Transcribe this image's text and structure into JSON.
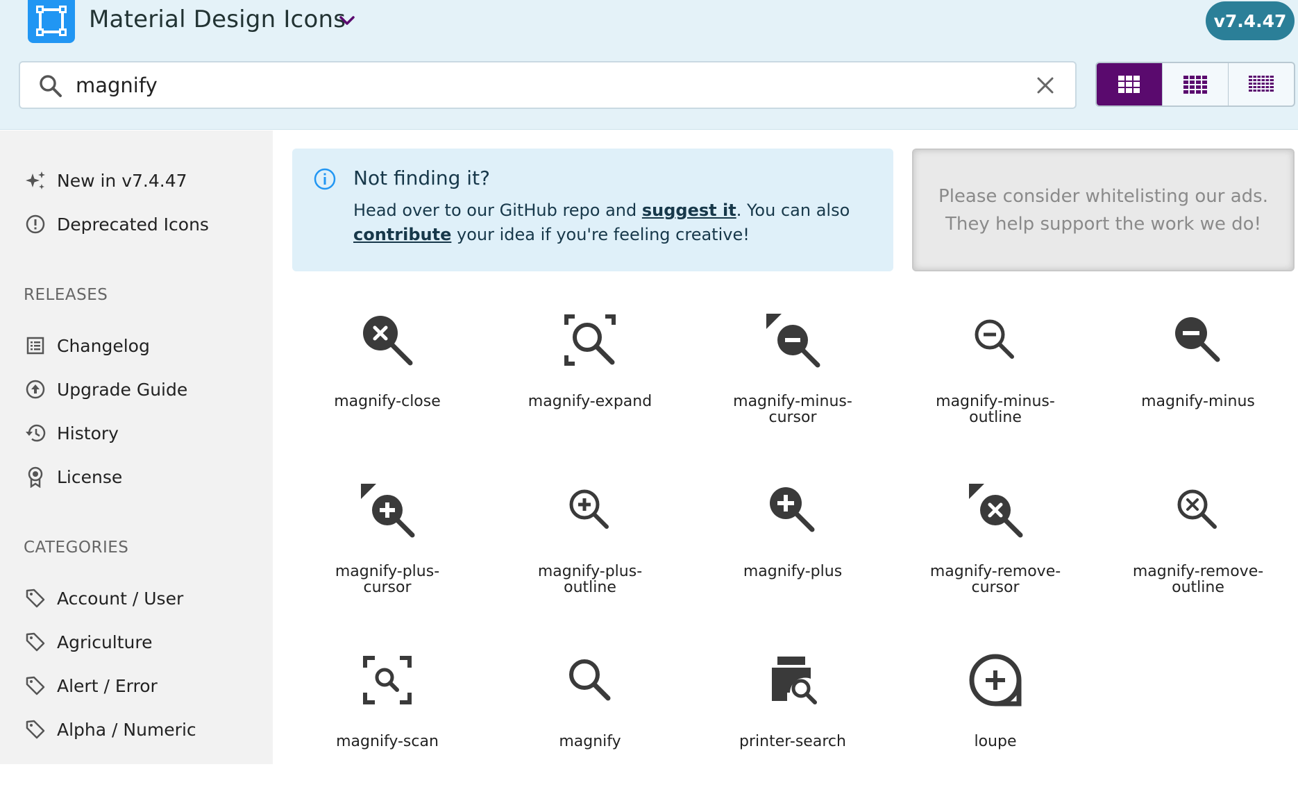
{
  "header": {
    "app_title": "Material Design Icons",
    "version": "v7.4.47",
    "search": {
      "value": "magnify",
      "placeholder": ""
    },
    "view_modes": [
      "large-grid",
      "medium-grid",
      "small-grid"
    ],
    "active_view": "large-grid"
  },
  "sidebar": {
    "top_items": [
      {
        "label": "New in v7.4.47",
        "icon": "sparkles-icon"
      },
      {
        "label": "Deprecated Icons",
        "icon": "alert-circle-icon"
      }
    ],
    "releases_heading": "RELEASES",
    "releases": [
      {
        "label": "Changelog",
        "icon": "list-icon"
      },
      {
        "label": "Upgrade Guide",
        "icon": "arrow-up-circle-icon"
      },
      {
        "label": "History",
        "icon": "history-icon"
      },
      {
        "label": "License",
        "icon": "certificate-icon"
      }
    ],
    "categories_heading": "CATEGORIES",
    "categories": [
      {
        "label": "Account / User",
        "icon": "tag-icon"
      },
      {
        "label": "Agriculture",
        "icon": "tag-icon"
      },
      {
        "label": "Alert / Error",
        "icon": "tag-icon"
      },
      {
        "label": "Alpha / Numeric",
        "icon": "tag-icon"
      }
    ]
  },
  "notice": {
    "title": "Not finding it?",
    "line1_pre": "Head over to our GitHub repo and ",
    "link_suggest": "suggest it",
    "line1_post": ". You can also ",
    "link_contribute": "contribute",
    "line2_post": " your idea if you're feeling creative!"
  },
  "ad": {
    "text": "Please consider whitelisting our ads. They help support the work we do!"
  },
  "icons": [
    {
      "name": "magnify-close",
      "label": "magnify-close"
    },
    {
      "name": "magnify-expand",
      "label": "magnify-expand"
    },
    {
      "name": "magnify-minus-cursor",
      "label": "magnify-minus-\ncursor"
    },
    {
      "name": "magnify-minus-outline",
      "label": "magnify-minus-\noutline"
    },
    {
      "name": "magnify-minus",
      "label": "magnify-minus"
    },
    {
      "name": "magnify-plus-cursor",
      "label": "magnify-plus-\ncursor"
    },
    {
      "name": "magnify-plus-outline",
      "label": "magnify-plus-\noutline"
    },
    {
      "name": "magnify-plus",
      "label": "magnify-plus"
    },
    {
      "name": "magnify-remove-cursor",
      "label": "magnify-remove-\ncursor"
    },
    {
      "name": "magnify-remove-outline",
      "label": "magnify-remove-\noutline"
    },
    {
      "name": "magnify-scan",
      "label": "magnify-scan"
    },
    {
      "name": "magnify",
      "label": "magnify"
    },
    {
      "name": "printer-search",
      "label": "printer-search"
    },
    {
      "name": "loupe",
      "label": "loupe"
    }
  ],
  "colors": {
    "header_bg": "#e4f2f8",
    "brand_blue": "#2196f3",
    "version_badge": "#2b7f98",
    "active_view": "#5a0a6e",
    "sidebar_bg": "#f2f2f2",
    "notice_bg": "#dff0f9",
    "icon": "#3a3a3a"
  }
}
